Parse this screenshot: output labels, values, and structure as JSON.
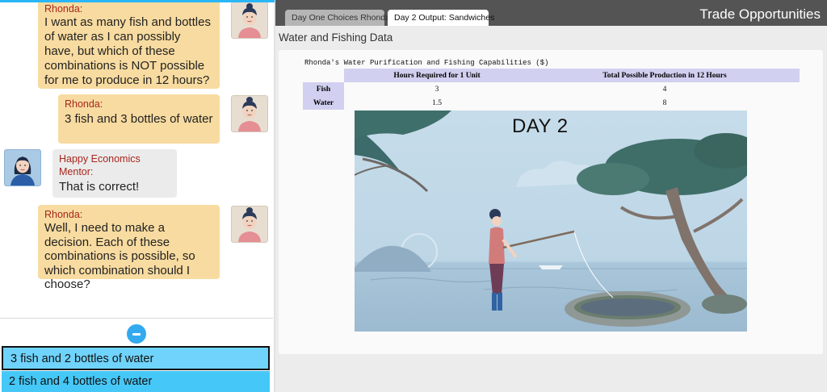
{
  "chat": {
    "messages": [
      {
        "speaker": "Rhonda:",
        "text": "I want as many fish and bottles of water as I can possibly have, but which of these combinations is NOT possible for me to produce in 12 hours?"
      },
      {
        "speaker": "Rhonda:",
        "text": "3 fish and 3 bottles of water"
      },
      {
        "speaker": "Happy Economics Mentor:",
        "text": "That is correct!"
      },
      {
        "speaker": "Rhonda:",
        "text": "Well, I need to make a decision. Each of these combinations is possible, so which combination should I choose?"
      }
    ],
    "choices": [
      {
        "label": "3 fish and 2 bottles of water",
        "selected": true
      },
      {
        "label": "2 fish and 4 bottles of water",
        "selected": false
      }
    ]
  },
  "tabs": [
    {
      "label": "Day One Choices Rhonda"
    },
    {
      "label": "Day 2 Output: Sandwiches"
    }
  ],
  "app_title": "Trade Opportunities",
  "section_title": "Water and Fishing Data",
  "table": {
    "caption": "Rhonda's Water Purification and Fishing Capabilities ($)",
    "headers": [
      "",
      "Hours Required for 1 Unit",
      "Total Possible Production in 12 Hours"
    ],
    "rows": [
      {
        "label": "Fish",
        "hours": "3",
        "total": "4"
      },
      {
        "label": "Water",
        "hours": "1.5",
        "total": "8"
      }
    ]
  },
  "scene": {
    "label": "DAY 2"
  },
  "colors": {
    "accent": "#29b6f6",
    "bubble_rhonda": "#f8dba0",
    "bubble_mentor": "#ebebeb",
    "speaker_name": "#a8261d",
    "choice_bg": "#6fd3fb",
    "table_header": "#d2d0f0",
    "tab_bar": "#545454"
  }
}
